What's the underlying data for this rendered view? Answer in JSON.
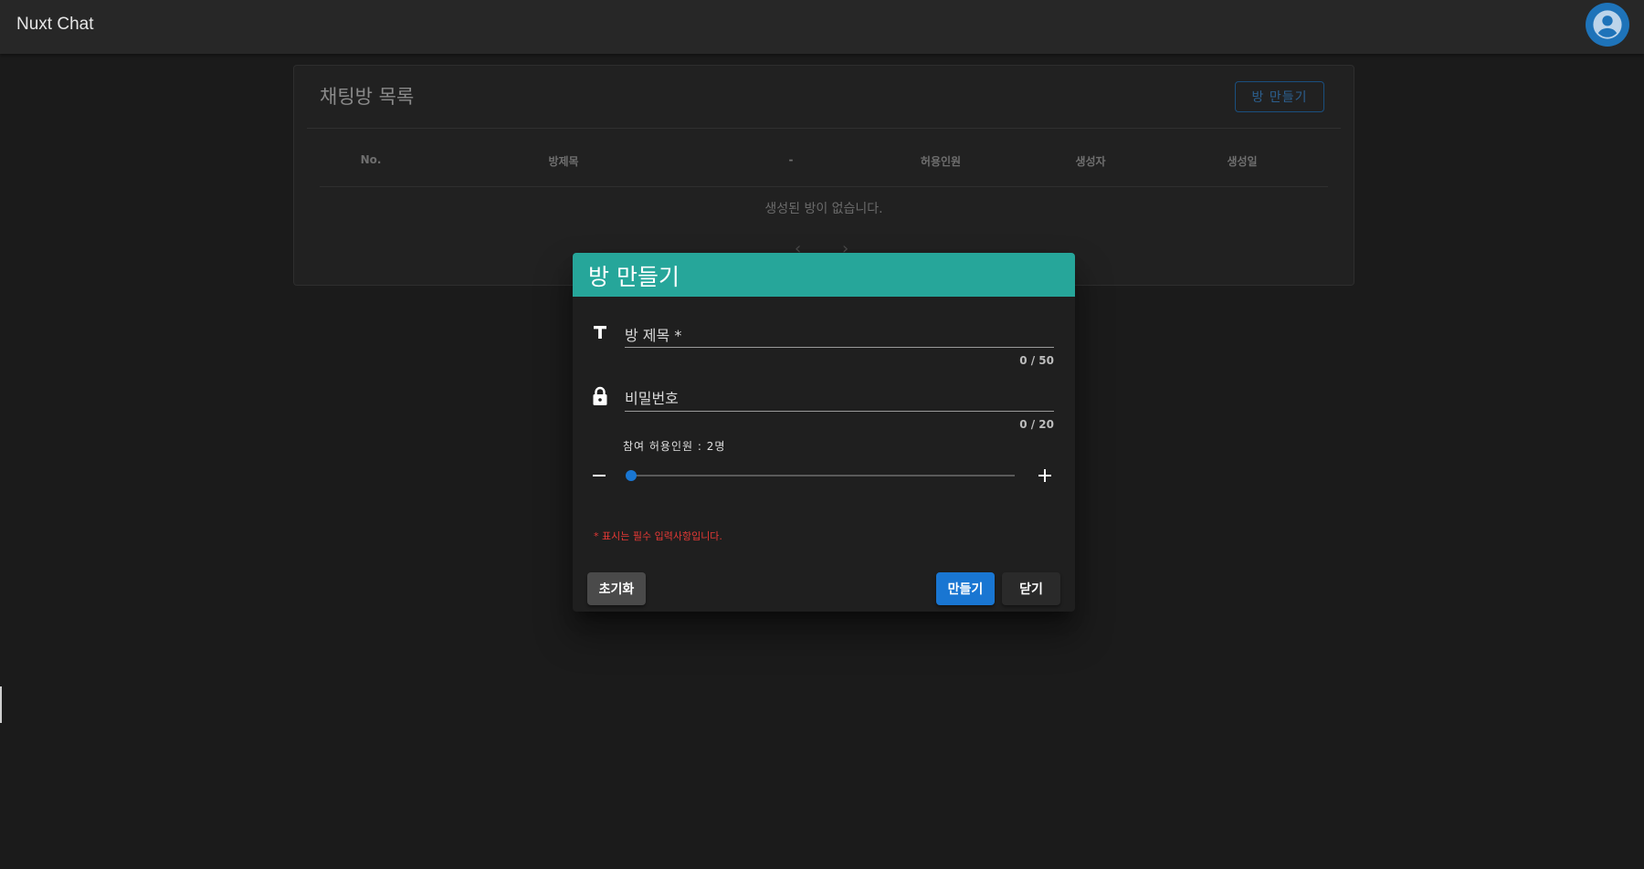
{
  "appbar": {
    "title": "Nuxt Chat",
    "avatar_icon": "account-circle-icon"
  },
  "room_list": {
    "title": "채팅방 목록",
    "create_button_label": "방 만들기",
    "columns": [
      "No.",
      "방제목",
      "-",
      "허용인원",
      "생성자",
      "생성일"
    ],
    "empty_message": "생성된 방이 없습니다.",
    "prev_icon": "chevron-left-icon",
    "next_icon": "chevron-right-icon"
  },
  "dialog": {
    "title": "방 만들기",
    "title_field": {
      "icon": "format-title-icon",
      "label": "방 제목 *",
      "value": "",
      "counter": "0 / 50"
    },
    "password_field": {
      "icon": "lock-icon",
      "label": "비밀번호",
      "value": "",
      "counter": "0 / 20"
    },
    "capacity": {
      "label": "참여 허용인원 : 2명",
      "value": 2,
      "fraction": 0.0,
      "minus_icon": "minus-icon",
      "plus_icon": "plus-icon"
    },
    "required_note": "* 표시는 필수 입력사항입니다.",
    "buttons": {
      "reset": "초기화",
      "submit": "만들기",
      "close": "닫기"
    }
  },
  "colors": {
    "appbar_bg": "#272727",
    "page_bg": "#1b1b1b",
    "dialog_header": "#26a69a",
    "primary": "#1976d2",
    "error": "#e53935",
    "avatar": "#1e73b9"
  }
}
